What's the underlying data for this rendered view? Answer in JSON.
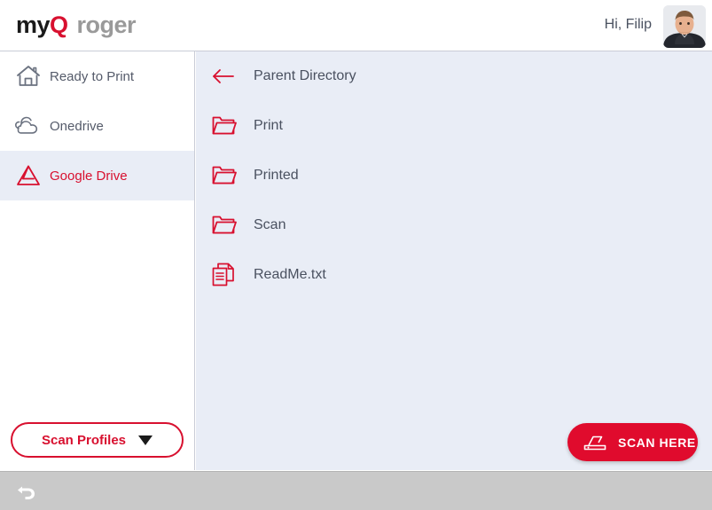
{
  "header": {
    "logo_my": "my",
    "logo_q": "Q",
    "logo_roger": "roger",
    "greeting": "Hi, Filip",
    "avatar_name": "user-avatar"
  },
  "sidebar": {
    "items": [
      {
        "label": "Ready to Print",
        "icon": "home-icon",
        "active": false
      },
      {
        "label": "Onedrive",
        "icon": "cloud-icon",
        "active": false
      },
      {
        "label": "Google Drive",
        "icon": "google-drive-icon",
        "active": true
      }
    ],
    "scan_profiles": {
      "label": "Scan Profiles",
      "caret_icon": "chevron-down-icon"
    }
  },
  "main": {
    "files": [
      {
        "label": "Parent Directory",
        "icon": "back-arrow-icon",
        "type": "parent"
      },
      {
        "label": "Print",
        "icon": "folder-icon",
        "type": "folder"
      },
      {
        "label": "Printed",
        "icon": "folder-icon",
        "type": "folder"
      },
      {
        "label": "Scan",
        "icon": "folder-icon",
        "type": "folder"
      },
      {
        "label": "ReadMe.txt",
        "icon": "document-icon",
        "type": "file"
      }
    ],
    "scan_here": {
      "label": "SCAN HERE",
      "icon": "scanner-icon"
    }
  },
  "navbar": {
    "back_icon": "back-undo-icon"
  },
  "colors": {
    "brand_red": "#d8102f",
    "button_red": "#e00b2d",
    "content_bg": "#e9edf6",
    "sidebar_active_bg": "#e9edf6",
    "text_gray": "#4a5160",
    "navbar_bg": "#c9c9c9"
  }
}
